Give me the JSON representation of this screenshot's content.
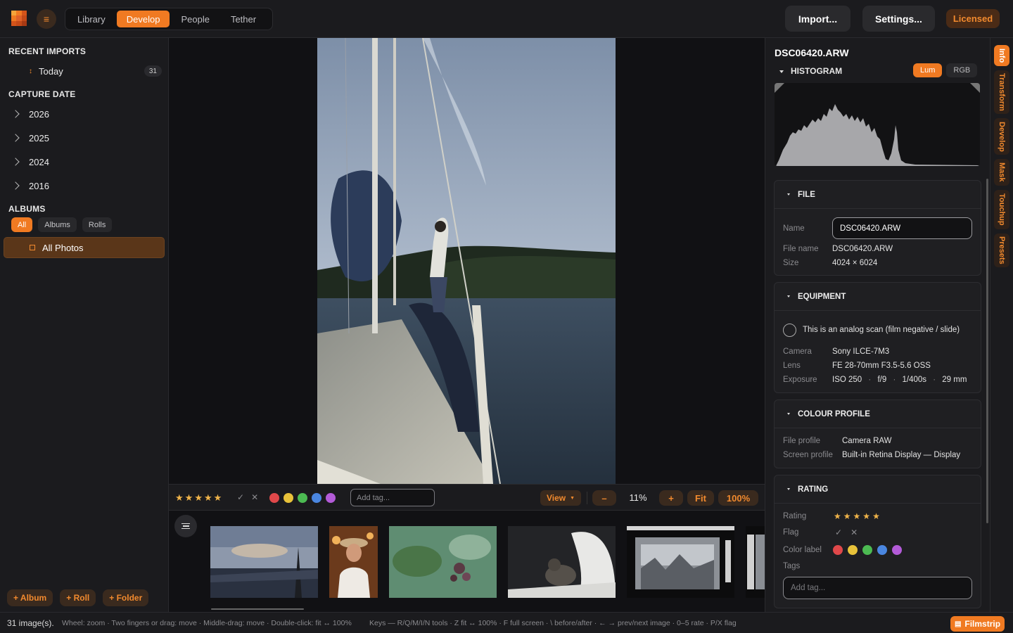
{
  "topbar": {
    "nav_tabs": [
      {
        "label": "Library"
      },
      {
        "label": "Develop"
      },
      {
        "label": "People"
      },
      {
        "label": "Tether"
      }
    ],
    "import_label": "Import...",
    "settings_label": "Settings...",
    "licensed_label": "Licensed",
    "accent": "#f07a22"
  },
  "sidebar": {
    "recent_imports": {
      "title": "RECENT IMPORTS",
      "items": [
        {
          "label": "Today",
          "count": "31"
        }
      ]
    },
    "capture_date": {
      "title": "CAPTURE DATE",
      "years": [
        {
          "label": "2026"
        },
        {
          "label": "2025"
        },
        {
          "label": "2024"
        },
        {
          "label": "2016"
        }
      ]
    },
    "albums": {
      "title": "ALBUMS",
      "filters": [
        {
          "label": "All"
        },
        {
          "label": "Albums"
        },
        {
          "label": "Rolls"
        }
      ],
      "items": [
        {
          "label": "All Photos"
        }
      ]
    },
    "buttons": {
      "album": "+ Album",
      "roll": "+ Roll",
      "folder": "+ Folder"
    }
  },
  "viewer": {
    "tag_placeholder": "Add tag...",
    "view_label": "View",
    "zoom_out": "–",
    "zoom_value": "11%",
    "zoom_in": "+",
    "fit_label": "Fit",
    "full_label": "100%",
    "stars": [
      "★",
      "★",
      "★",
      "★",
      "★"
    ],
    "flags": {
      "pick": "✓",
      "reject": "✕"
    },
    "color_labels": [
      "#e0484a",
      "#e8c23a",
      "#4cba52",
      "#4a86e0",
      "#b35bd8"
    ]
  },
  "info_panel": {
    "filename": "DSC06420.ARW",
    "histogram": {
      "title": "HISTOGRAM",
      "modes": [
        {
          "label": "Lum"
        },
        {
          "label": "RGB"
        }
      ]
    },
    "file": {
      "title": "FILE",
      "name_label": "Name",
      "name_value": "DSC06420.ARW",
      "file_name_label": "File name",
      "file_name_value": "DSC06420.ARW",
      "size_label": "Size",
      "size_value": "4024 × 6024"
    },
    "equipment": {
      "title": "EQUIPMENT",
      "analog_label": "This is an analog scan (film negative / slide)",
      "camera_label": "Camera",
      "camera_value": "Sony ILCE-7M3",
      "lens_label": "Lens",
      "lens_value": "FE 28-70mm F3.5-5.6 OSS",
      "exposure_label": "Exposure",
      "iso": "ISO 250",
      "aperture": "f/9",
      "shutter": "1/400s",
      "focal": "29 mm",
      "sep": "·"
    },
    "colour_profile": {
      "title": "COLOUR PROFILE",
      "file_profile_label": "File profile",
      "file_profile_value": "Camera RAW",
      "screen_profile_label": "Screen profile",
      "screen_profile_value": "Built-in Retina Display — Display"
    },
    "rating": {
      "title": "RATING",
      "rating_label": "Rating",
      "flag_label": "Flag",
      "color_label": "Color label",
      "tags_label": "Tags",
      "tags_placeholder": "Add tag...",
      "stars": [
        "★",
        "★",
        "★",
        "★",
        "★"
      ],
      "flags": {
        "pick": "✓",
        "reject": "✕"
      },
      "colors": [
        "#e0484a",
        "#e8c23a",
        "#4cba52",
        "#4a86e0",
        "#b35bd8"
      ]
    }
  },
  "side_tabs": [
    {
      "label": "Info"
    },
    {
      "label": "Transform"
    },
    {
      "label": "Develop"
    },
    {
      "label": "Mask"
    },
    {
      "label": "Touchup"
    },
    {
      "label": "Presets"
    }
  ],
  "statusbar": {
    "count": "31 image(s).",
    "hint_mouse": "Wheel: zoom · Two fingers or drag: move · Middle-drag: move · Double-click: fit ↔ 100%",
    "hint_keys": "Keys — R/Q/M/I/N tools · Z fit ↔ 100% · F full screen · \\ before/after · ← → prev/next image · 0–5 rate · P/X flag",
    "filmstrip_label": "Filmstrip"
  }
}
